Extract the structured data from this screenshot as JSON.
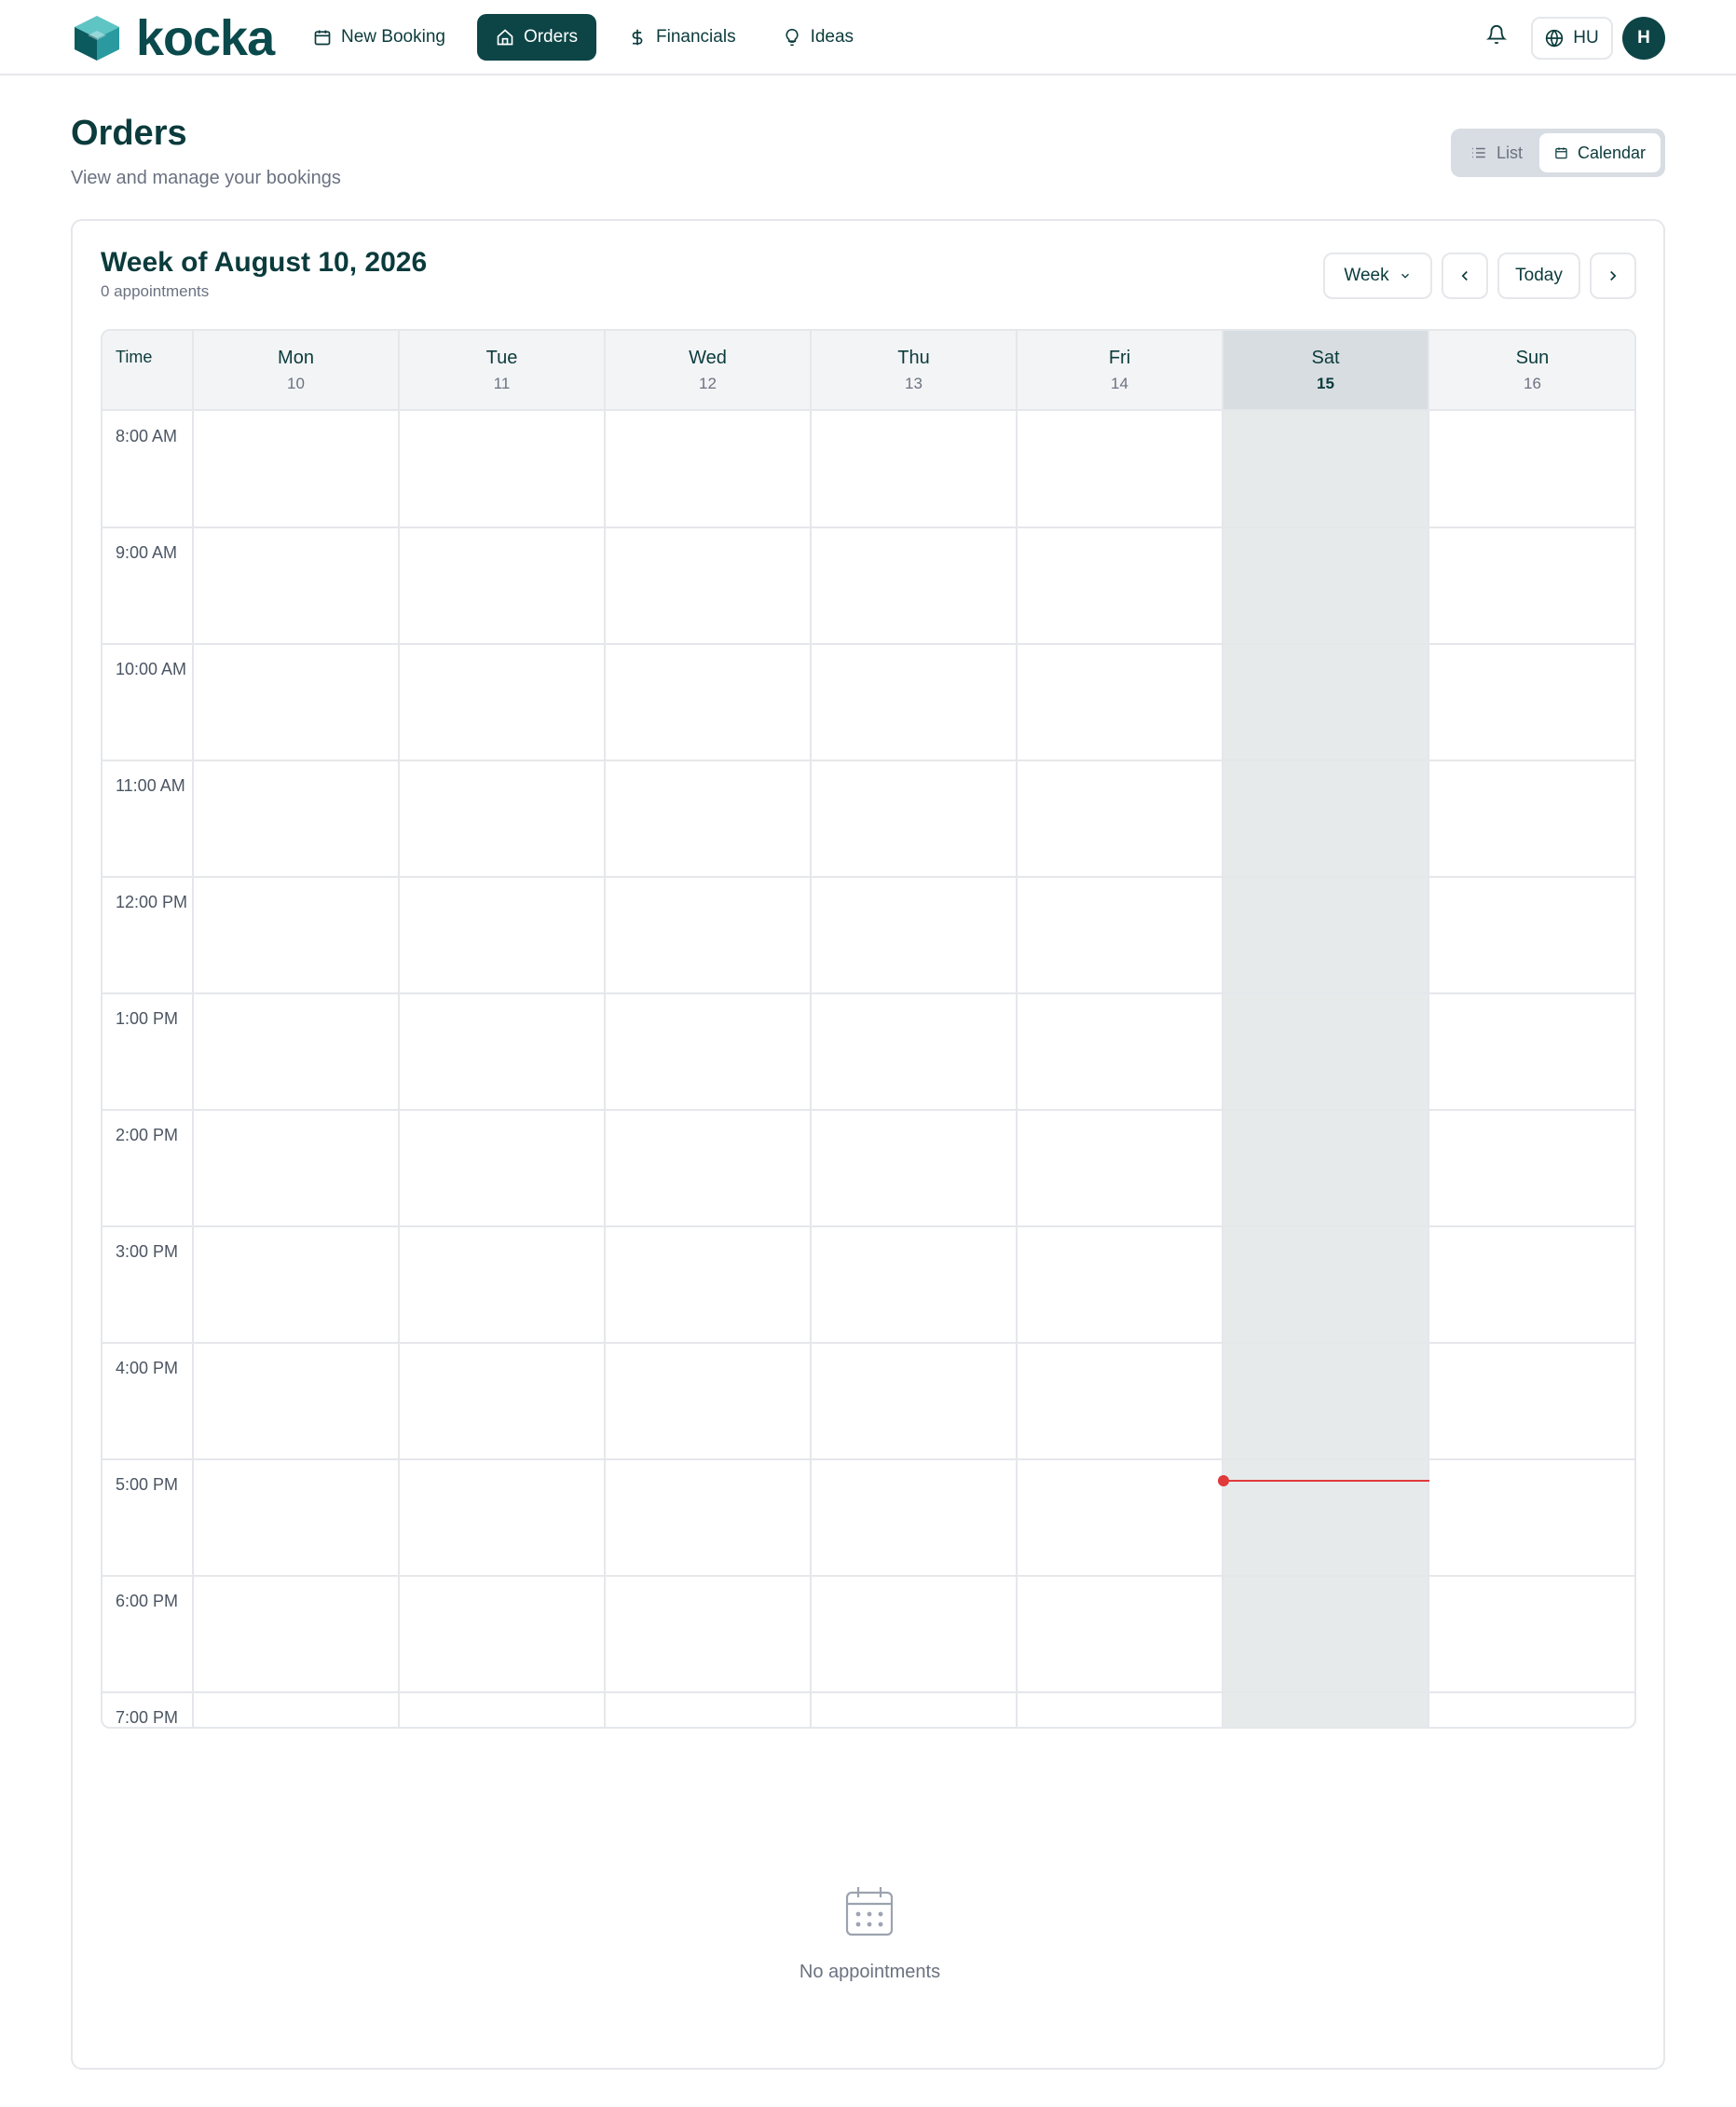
{
  "app": {
    "logo_text": "kocka"
  },
  "nav": {
    "items": [
      {
        "label": "New Booking",
        "icon": "calendar-icon"
      },
      {
        "label": "Orders",
        "icon": "home-icon",
        "active": true
      },
      {
        "label": "Financials",
        "icon": "dollar-icon"
      },
      {
        "label": "Ideas",
        "icon": "lightbulb-icon"
      }
    ],
    "language": "HU",
    "avatar_initial": "H"
  },
  "page": {
    "title": "Orders",
    "subtitle": "View and manage your bookings"
  },
  "view_toggle": {
    "list_label": "List",
    "calendar_label": "Calendar",
    "selected": "Calendar"
  },
  "calendar": {
    "week_title": "Week of August 10, 2026",
    "appointments_count": "0 appointments",
    "range_select": "Week",
    "today_label": "Today",
    "time_header": "Time",
    "days": [
      {
        "name": "Mon",
        "num": "10"
      },
      {
        "name": "Tue",
        "num": "11"
      },
      {
        "name": "Wed",
        "num": "12"
      },
      {
        "name": "Thu",
        "num": "13"
      },
      {
        "name": "Fri",
        "num": "14"
      },
      {
        "name": "Sat",
        "num": "15",
        "today": true
      },
      {
        "name": "Sun",
        "num": "16"
      }
    ],
    "times": [
      "8:00 AM",
      "9:00 AM",
      "10:00 AM",
      "11:00 AM",
      "12:00 PM",
      "1:00 PM",
      "2:00 PM",
      "3:00 PM",
      "4:00 PM",
      "5:00 PM",
      "6:00 PM",
      "7:00 PM"
    ],
    "empty_text": "No appointments"
  },
  "colors": {
    "brand": "#0d4547",
    "now_indicator": "#e03a3a",
    "today_column": "#e6eaeb"
  }
}
